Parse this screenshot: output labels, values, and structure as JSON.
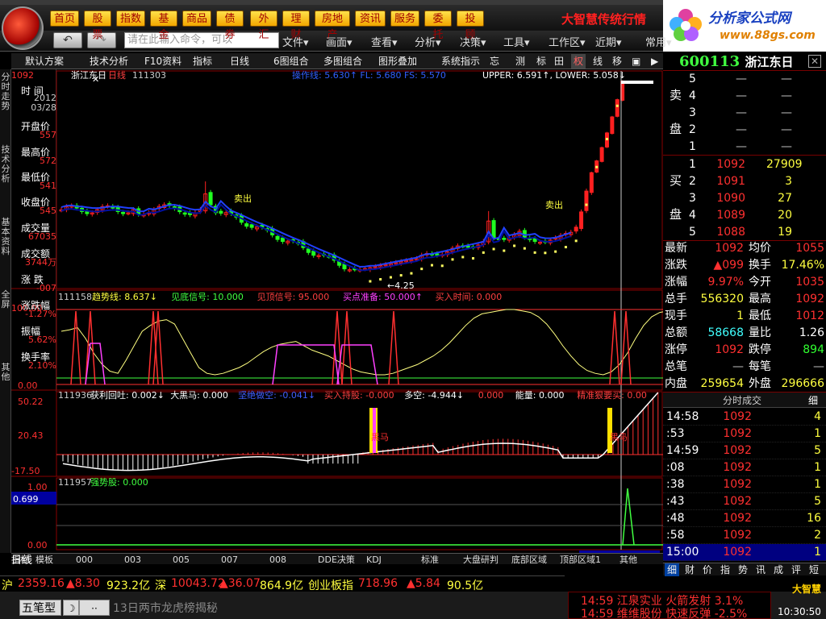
{
  "menu1": [
    "首页",
    "股票",
    "指数",
    "基金",
    "商品",
    "债券",
    "外汇",
    "理财",
    "房地产",
    "资讯",
    "服务",
    "委托",
    "投顾"
  ],
  "brand": "大智慧传统行情",
  "site": {
    "name": "分析家公式网",
    "url": "www.88gs.com"
  },
  "nav": {
    "back": "↶",
    "fwd": "↷",
    "cmd_placeholder": "请在此输入命令，可以"
  },
  "menu2": [
    "文件▾",
    "画面▾",
    "查看▾",
    "分析▾",
    "决策▾",
    "工具▾",
    "工作区▾",
    "近期▾",
    "常用▾"
  ],
  "tabs": [
    "默认方案",
    "技术分析",
    "F10资料",
    "指标",
    "日线",
    "6图组合",
    "多图组合",
    "图形叠加",
    "系统指示",
    "忘",
    "测",
    "标",
    "田",
    "权",
    "线",
    "移",
    "▣",
    "▶"
  ],
  "sidebar_v": [
    "分时走势",
    "技术分析",
    "基本资料",
    "全屏",
    "其他"
  ],
  "info": {
    "labels": [
      "时 间",
      "开盘价",
      "最高价",
      "最低价",
      "收盘价",
      "成交量",
      "成交额",
      "涨 跌",
      "涨跌幅",
      "振幅",
      "换手率"
    ],
    "values": [
      "2012\n03/28",
      "557",
      "572",
      "541",
      "545",
      "67035",
      "3744万",
      "-007",
      "-1.27%",
      "5.62%",
      "2.10%"
    ]
  },
  "chart_header": {
    "name": "浙江东日",
    "period": "日线",
    "id": "111303",
    "ma_text": "操作线: 5.630↑ FL: 5.680 FS: 5.570",
    "upper": "UPPER: 6.591↑, LOWER: 5.058↓"
  },
  "panel2": {
    "id": "111158",
    "text": [
      "趋势线: 8.637↓",
      "见底信号: 10.000",
      "见顶信号: 95.000",
      "买点准备: 50.000↑",
      "买入时间: 0.000"
    ]
  },
  "panel3": {
    "id": "111936",
    "text": [
      "获利回吐: 0.002↓",
      "大黑马: 0.000",
      "坚绝做空: -0.041↓",
      "买入持股: -0.000",
      "多空: -4.944↓",
      "0.000",
      "能量: 0.000",
      "精准狠要买: 0.00"
    ]
  },
  "panel4": {
    "id": "111957",
    "text": "强势股: 0.000"
  },
  "yaxis": {
    "p1_top": "1092",
    "p2": [
      "100.00",
      "0.00"
    ],
    "p3": [
      "50.22",
      "20.43",
      "-17.50"
    ],
    "p4": [
      "1.00",
      "0.699",
      "0.00"
    ]
  },
  "annotations": {
    "sell": "卖出",
    "low": "4.25",
    "horse": "黑马"
  },
  "xdates": [
    "2011/09/10",
    "11",
    "12",
    "2012/01",
    "02",
    "03"
  ],
  "xcursor": "2012/03/28(三)",
  "bottom_tabs": [
    "指标",
    "模板",
    "000",
    "003",
    "005",
    "007",
    "008",
    "DDE决策",
    "KDJ",
    "标准",
    "大盘研判",
    "底部区域",
    "顶部区域1",
    "其他"
  ],
  "bottom_left": "日线",
  "stock": {
    "code": "600113",
    "name": "浙江东日"
  },
  "sell_orders": [
    [
      "5",
      "—",
      "—"
    ],
    [
      "4",
      "—",
      "—"
    ],
    [
      "3",
      "—",
      "—"
    ],
    [
      "2",
      "—",
      "—"
    ],
    [
      "1",
      "—",
      "—"
    ]
  ],
  "buy_orders": [
    [
      "1",
      "1092",
      "27909"
    ],
    [
      "2",
      "1091",
      "3"
    ],
    [
      "3",
      "1090",
      "27"
    ],
    [
      "4",
      "1089",
      "20"
    ],
    [
      "5",
      "1088",
      "19"
    ]
  ],
  "quote": [
    [
      "最新",
      "1092",
      "均价",
      "1055"
    ],
    [
      "涨跌",
      "▲099",
      "换手",
      "17.46%"
    ],
    [
      "涨幅",
      "9.97%",
      "今开",
      "1035"
    ],
    [
      "总手",
      "556320",
      "最高",
      "1092"
    ],
    [
      "现手",
      "1",
      "最低",
      "1012"
    ],
    [
      "总额",
      "58668",
      "量比",
      "1.26"
    ],
    [
      "涨停",
      "1092",
      "跌停",
      "894"
    ],
    [
      "总笔",
      "—",
      "每笔",
      "—"
    ],
    [
      "内盘",
      "259654",
      "外盘",
      "296666"
    ]
  ],
  "ticks_header": "分时成交",
  "ticks_tab": "细",
  "ticks": [
    [
      "14:58",
      "1092",
      "4"
    ],
    [
      ":53",
      "1092",
      "1"
    ],
    [
      "14:59",
      "1092",
      "5"
    ],
    [
      ":08",
      "1092",
      "1"
    ],
    [
      ":38",
      "1092",
      "1"
    ],
    [
      ":43",
      "1092",
      "5"
    ],
    [
      ":48",
      "1092",
      "16"
    ],
    [
      ":58",
      "1092",
      "2"
    ],
    [
      "15:00",
      "1092",
      "1"
    ]
  ],
  "rtabs": [
    "细",
    "财",
    "价",
    "指",
    "势",
    "讯",
    "成",
    "评",
    "短"
  ],
  "ticker": [
    {
      "name": "沪",
      "price": "2359.16",
      "chg": "▲8.30",
      "amt": "923.2亿"
    },
    {
      "name": "深",
      "price": "10043.72",
      "chg": "▲36.07",
      "amt": "864.9亿"
    },
    {
      "name": "创业板指",
      "price": "718.96",
      "chg": "▲5.84",
      "amt": "90.5亿"
    }
  ],
  "status": {
    "mode": "五笔型",
    "news": "13日两市龙虎榜揭秘",
    "alert1": "14:59 江泉实业 火箭发射 3.1%",
    "alert2": "14:59 维维股份 快速反弹 -2.5%",
    "time": "10:30:50",
    "logo": "大智慧"
  },
  "chart_data": {
    "type": "candlestick",
    "note": "daily K-line, price in 0.01 yuan units as displayed",
    "low_marker": "4.25",
    "last_close": "10.92"
  }
}
